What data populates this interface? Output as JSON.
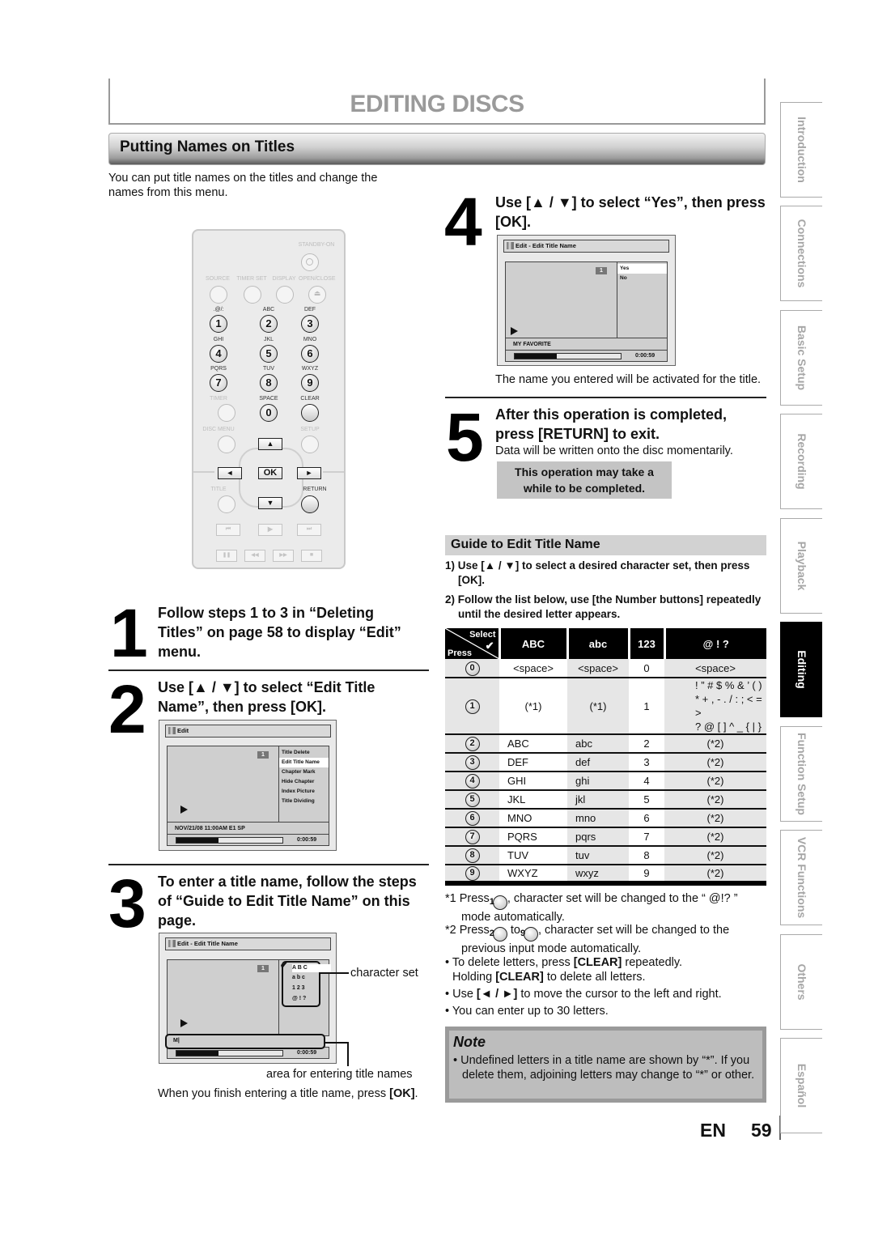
{
  "page_title": "EDITING DISCS",
  "section_title": "Putting Names on Titles",
  "intro": "You can put title names on the titles and change the names from this menu.",
  "remote": {
    "standby_label": "STANDBY-ON",
    "top_labels": [
      "SOURCE",
      "TIMER SET",
      "DISPLAY",
      "OPEN/CLOSE"
    ],
    "key_letters": [
      ".@/:",
      "ABC",
      "DEF",
      "GHI",
      "JKL",
      "MNO",
      "PQRS",
      "TUV",
      "WXYZ"
    ],
    "keys": [
      "1",
      "2",
      "3",
      "4",
      "5",
      "6",
      "7",
      "8",
      "9",
      "0"
    ],
    "timer_label": "TIMER",
    "space_label": "SPACE",
    "clear_label": "CLEAR",
    "disc_menu_label": "DISC MENU",
    "setup_label": "SETUP",
    "ok_label": "OK",
    "title_label": "TITLE",
    "return_label": "RETURN",
    "up": "▲",
    "down": "▼",
    "left": "◄",
    "right": "►",
    "skip_back": "⏮",
    "play": "▶",
    "skip_fwd": "⏭",
    "pause": "❚❚",
    "rew": "◀◀",
    "ff": "▶▶",
    "stop": "■"
  },
  "steps": [
    {
      "num": "1",
      "text": "Follow steps 1 to 3 in “Deleting Titles” on page 58 to display “Edit” menu."
    },
    {
      "num": "2",
      "text": "Use [▲ / ▼] to select “Edit Title Name”, then press [OK]."
    },
    {
      "num": "3",
      "text": "To enter a title name, follow the steps of “Guide to Edit Title Name” on this page."
    },
    {
      "num": "4",
      "text": "Use [▲ / ▼] to select “Yes”, then press [OK]."
    },
    {
      "num": "5",
      "text": "After this operation is completed, press [RETURN] to exit."
    }
  ],
  "osd_edit": {
    "header": "Edit",
    "badge": "1",
    "menu": [
      "Title Delete",
      "Edit Title Name",
      "Chapter Mark",
      "Hide Chapter",
      "Index Picture",
      "Title Dividing"
    ],
    "selected_index": 1,
    "info": "NOV/21/08 11:00AM  E1 SP",
    "time": "0:00:59",
    "progress": 0.4
  },
  "osd_name": {
    "header": "Edit - Edit Title Name",
    "badge": "1",
    "charsets": [
      "A  B  C",
      "a  b  c",
      "1  2  3",
      "@  !  ?"
    ],
    "input": "M|",
    "time": "0:00:59",
    "progress": 0.4,
    "callout_charset": "character set",
    "callout_input": "area for entering title names",
    "finish_text_pre": "When you finish entering a title name, press ",
    "finish_text_key": "[OK]",
    "finish_text_post": "."
  },
  "osd_yes": {
    "header": "Edit - Edit Title Name",
    "badge": "1",
    "options": [
      "Yes",
      "No"
    ],
    "info": "MY FAVORITE",
    "time": "0:00:59",
    "progress": 0.4,
    "caption": "The name you entered will be activated for the title."
  },
  "step5_sub": "Data will be written onto the disc momentarily.",
  "warning": "This operation may take a while to be completed.",
  "guide": {
    "title": "Guide to Edit Title Name",
    "items": [
      "1) Use [▲ / ▼] to select a desired character set, then press [OK].",
      "2) Follow the list below, use [the Number buttons] repeatedly until the desired letter appears."
    ],
    "table": {
      "corner_select": "Select",
      "corner_press": "Press",
      "headers": [
        "ABC",
        "abc",
        "123",
        "@ ! ?"
      ],
      "rows": [
        {
          "key": "0",
          "cells": [
            "<space>",
            "<space>",
            "0",
            "<space>"
          ]
        },
        {
          "key": "1",
          "cells": [
            "(*1)",
            "(*1)",
            "1",
            "! ” # $ % & ’ ( )\n* + , - . / : ; < = >\n? @ [ ] ^ _ { | }"
          ]
        },
        {
          "key": "2",
          "cells": [
            "ABC",
            "abc",
            "2",
            "(*2)"
          ]
        },
        {
          "key": "3",
          "cells": [
            "DEF",
            "def",
            "3",
            "(*2)"
          ]
        },
        {
          "key": "4",
          "cells": [
            "GHI",
            "ghi",
            "4",
            "(*2)"
          ]
        },
        {
          "key": "5",
          "cells": [
            "JKL",
            "jkl",
            "5",
            "(*2)"
          ]
        },
        {
          "key": "6",
          "cells": [
            "MNO",
            "mno",
            "6",
            "(*2)"
          ]
        },
        {
          "key": "7",
          "cells": [
            "PQRS",
            "pqrs",
            "7",
            "(*2)"
          ]
        },
        {
          "key": "8",
          "cells": [
            "TUV",
            "tuv",
            "8",
            "(*2)"
          ]
        },
        {
          "key": "9",
          "cells": [
            "WXYZ",
            "wxyz",
            "9",
            "(*2)"
          ]
        }
      ]
    },
    "footnotes": {
      "f1_pre": "*1 Press ",
      "f1_key": "1",
      "f1_post": ", character set will be changed to the “ @!? ” mode automatically.",
      "f2_pre": "*2 Press ",
      "f2_key_a": "2",
      "f2_mid": " to ",
      "f2_key_b": "9",
      "f2_post": ", character set will be changed to the previous input mode automatically.",
      "b1_pre": "• To delete letters, press ",
      "b1_key": "[CLEAR]",
      "b1_post": " repeatedly.",
      "b1b_pre": "Holding ",
      "b1b_key": "[CLEAR]",
      "b1b_post": " to delete all letters.",
      "b2_pre": "• Use ",
      "b2_key": "[◄ / ►]",
      "b2_post": " to move the cursor to the left and right.",
      "b3": "• You can enter up to 30 letters."
    }
  },
  "note": {
    "title": "Note",
    "text": "• Undefined letters in a title name are shown by “*”. If you delete them, adjoining letters may change to “*” or other."
  },
  "footer": {
    "lang": "EN",
    "page": "59"
  },
  "side_tabs": [
    {
      "label": "Introduction",
      "active": false
    },
    {
      "label": "Connections",
      "active": false
    },
    {
      "label": "Basic Setup",
      "active": false
    },
    {
      "label": "Recording",
      "active": false
    },
    {
      "label": "Playback",
      "active": false
    },
    {
      "label": "Editing",
      "active": true
    },
    {
      "label": "Function Setup",
      "active": false
    },
    {
      "label": "VCR Functions",
      "active": false
    },
    {
      "label": "Others",
      "active": false
    },
    {
      "label": "Español",
      "active": false
    }
  ]
}
